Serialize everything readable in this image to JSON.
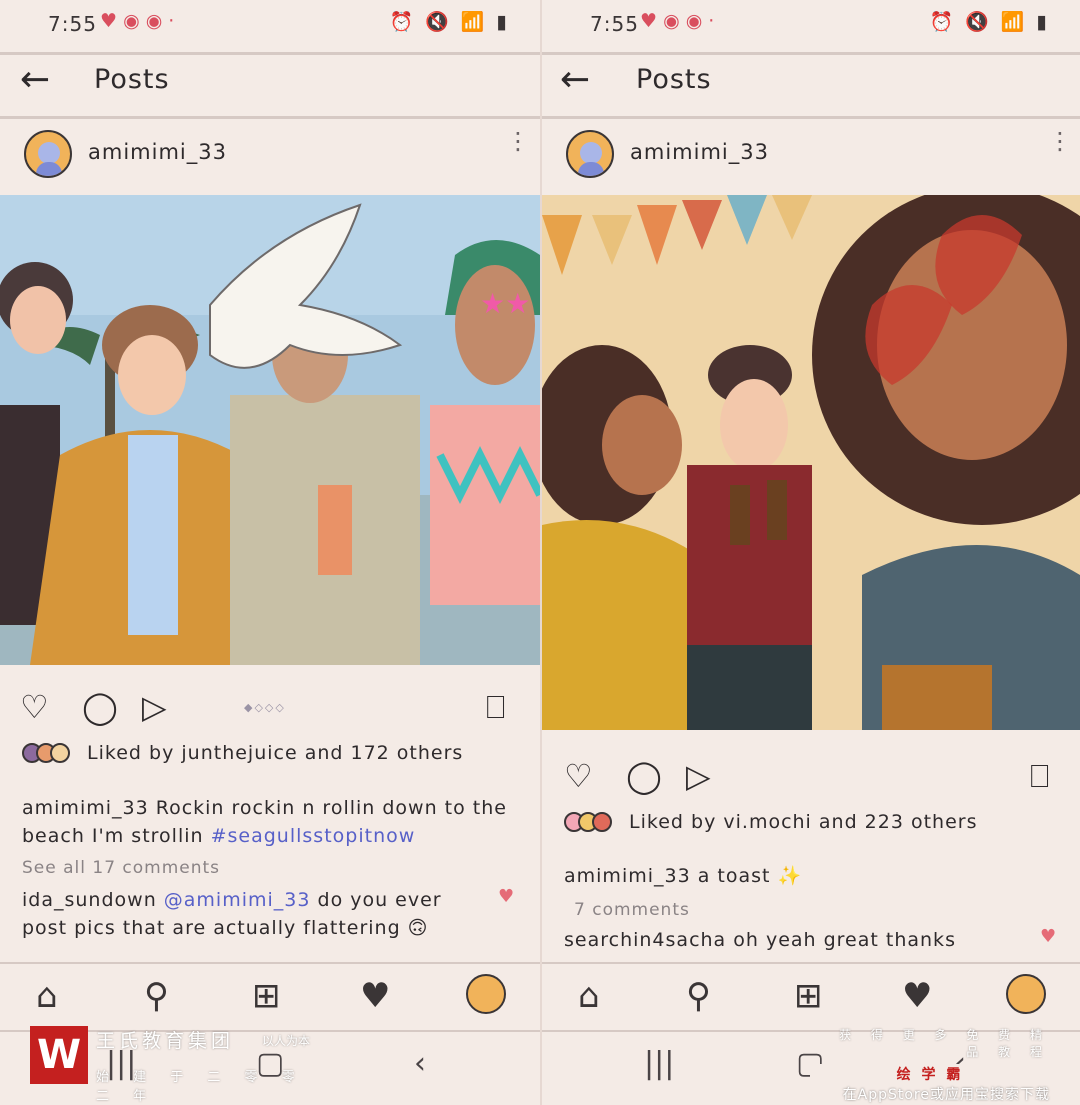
{
  "left": {
    "status": {
      "time": "7:55",
      "notif_icons": "♥ ◉ ◉ ·",
      "sys_icons": "⏰ 🔇 📶 ▮"
    },
    "appbar": {
      "back": "←",
      "title": "Posts"
    },
    "post": {
      "username": "amimimi_33",
      "more": "⋮",
      "carousel_dots": "◆◇◇◇",
      "likes_prefix": "Liked by ",
      "likes_user": "junthejuice",
      "likes_suffix": " and 172 others",
      "caption_user": "amimimi_33",
      "caption_text": " Rockin rockin n rollin down to the beach I'm strollin ",
      "caption_hashtag": "#seagullsstopitnow",
      "comments_link": "See all 17 comments",
      "comment_user": "ida_sundown",
      "comment_mention": "@amimimi_33",
      "comment_text": " do you ever post pics that are actually flattering 🙃"
    }
  },
  "right": {
    "status": {
      "time": "7:55",
      "notif_icons": "♥ ◉ ◉ ·",
      "sys_icons": "⏰ 🔇 📶 ▮"
    },
    "appbar": {
      "back": "←",
      "title": "Posts"
    },
    "post": {
      "username": "amimimi_33",
      "more": "⋮",
      "likes_prefix": "Liked by ",
      "likes_user": "vi.mochi",
      "likes_suffix": " and 223 others",
      "caption_user": "amimimi_33",
      "caption_text": " a toast ✨",
      "comments_link": "7 comments",
      "comment_user": "searchin4sacha",
      "comment_text": " oh yeah great thanks"
    }
  },
  "icons": {
    "heart": "♡",
    "comment": "◯",
    "share": "▷",
    "bookmark": "⎕",
    "home": "⌂",
    "search": "⚲",
    "add": "⊞",
    "activity": "♥",
    "nav_recent": "|||",
    "nav_home": "▢",
    "nav_back": "‹"
  },
  "watermark": {
    "logo": "W",
    "title": "王氏教育集团",
    "motto": "以人为本",
    "sub": "始 建 于 二 零 零 二 年",
    "right_top": "获 得 更 多 免 费 精 品 教 程",
    "right_badge": "绘 学 霸",
    "right_bottom": "在AppStore或应用宝搜索下载"
  },
  "colors": {
    "bg": "#f4ebe6",
    "accent_link": "#5760c8",
    "like_red": "#e56b77"
  }
}
